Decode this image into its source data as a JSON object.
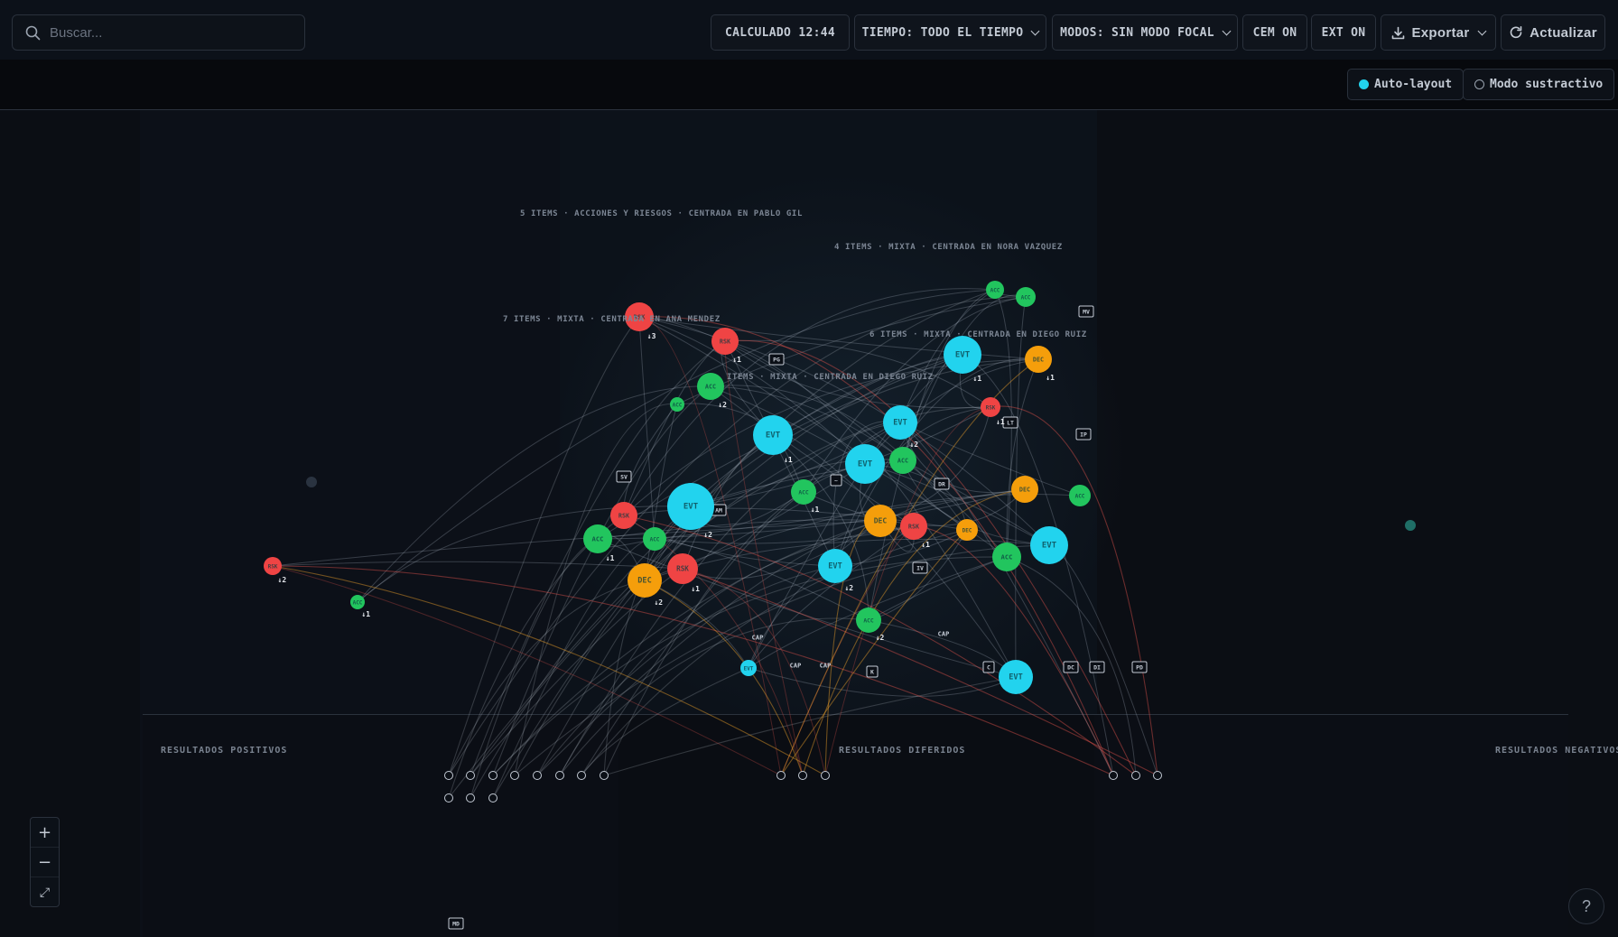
{
  "search": {
    "placeholder": "Buscar..."
  },
  "toolbar": {
    "calc": "CALCULADO 12:44",
    "time": "TIEMPO: TODO EL TIEMPO",
    "modes": "MODOS: SIN MODO FOCAL",
    "cem": "CEM ON",
    "ext": "EXT ON",
    "export": "Exportar",
    "refresh": "Actualizar"
  },
  "subbar": {
    "autolayout": "Auto-layout",
    "subtractive": "Modo sustractivo"
  },
  "colors": {
    "evt": "#22d3ee",
    "acc": "#22c55e",
    "rsk": "#ef4444",
    "dec": "#f59e0b",
    "background": "#0b0f16"
  },
  "clusters": [
    "5 ITEMS · ACCIONES Y RIESGOS · CENTRADA EN PABLO GIL",
    "4 ITEMS · MIXTA · CENTRADA EN NORA VAZQUEZ",
    "7 ITEMS · MIXTA · CENTRADA EN ANA MENDEZ",
    "6 ITEMS · MIXTA · CENTRADA EN DIEGO RUIZ",
    "ITEMS · MIXTA · CENTRADA EN DIEGO RUIZ"
  ],
  "outcomes": {
    "positive": "RESULTADOS POSITIVOS",
    "deferred": "RESULTADOS DIFERIDOS",
    "negative": "RESULTADOS NEGATIVOS"
  },
  "nodes": [
    {
      "t": "RSK",
      "b": "↓3"
    },
    {
      "t": "RSK",
      "b": "↓1"
    },
    {
      "t": "ACC",
      "b": "↓2"
    },
    {
      "t": "ACC",
      "b": ""
    },
    {
      "t": "EVT",
      "b": "↓1"
    },
    {
      "t": "EVT",
      "b": "↓2"
    },
    {
      "t": "ACC",
      "b": "↓1"
    },
    {
      "t": "EVT",
      "b": ""
    },
    {
      "t": "EVT",
      "b": "↓1"
    },
    {
      "t": "DEC",
      "b": "↓1"
    },
    {
      "t": "ACC",
      "b": ""
    },
    {
      "t": "ACC",
      "b": ""
    },
    {
      "t": "RSK",
      "b": "↓1"
    },
    {
      "t": "DEC",
      "b": ""
    },
    {
      "t": "ACC",
      "b": ""
    },
    {
      "t": "DEC",
      "b": ""
    },
    {
      "t": "RSK",
      "b": "↓1"
    },
    {
      "t": "DEC",
      "b": ""
    },
    {
      "t": "EVT",
      "b": "↓2"
    },
    {
      "t": "RSK",
      "b": ""
    },
    {
      "t": "ACC",
      "b": "↓1"
    },
    {
      "t": "ACC",
      "b": ""
    },
    {
      "t": "DEC",
      "b": "↓2"
    },
    {
      "t": "RSK",
      "b": "↓1"
    },
    {
      "t": "ACC",
      "b": ""
    },
    {
      "t": "EVT",
      "b": ""
    },
    {
      "t": "EVT",
      "b": "↓2"
    },
    {
      "t": "ACC",
      "b": "↓2"
    },
    {
      "t": "EVT",
      "b": ""
    },
    {
      "t": "EVT",
      "b": ""
    },
    {
      "t": "RSK",
      "b": "↓2"
    },
    {
      "t": "ACC",
      "b": "↓1"
    },
    {
      "t": "ACC",
      "b": ""
    }
  ],
  "tags": [
    "MV",
    "PG",
    "LT",
    "IP",
    "DR",
    "SV",
    "AM",
    "IV",
    "MD",
    "K",
    "C",
    "DC",
    "DI",
    "PD",
    "~",
    "CAP",
    "CAP",
    "CAP",
    "CAP"
  ],
  "zoom": {
    "in": "+",
    "out": "−",
    "fit": "⤢"
  },
  "help": "?"
}
